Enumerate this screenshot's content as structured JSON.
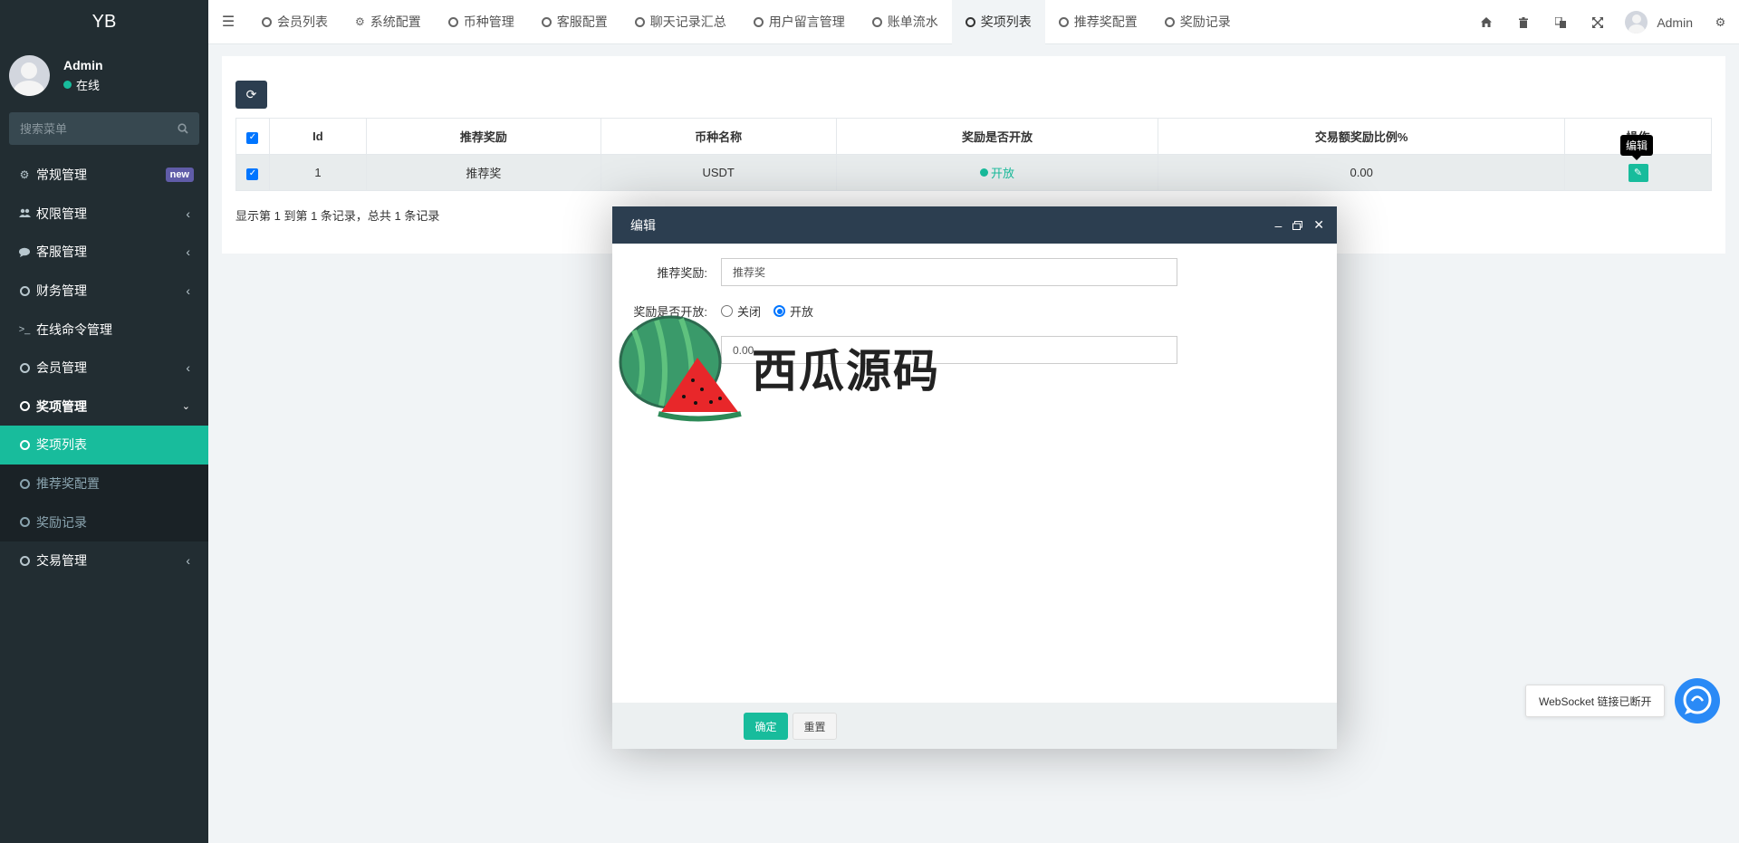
{
  "sidebar": {
    "logo": "YB",
    "user_name": "Admin",
    "user_status": "在线",
    "search_placeholder": "搜索菜单",
    "items": [
      {
        "label": "常规管理",
        "badge": "new"
      },
      {
        "label": "权限管理"
      },
      {
        "label": "客服管理"
      },
      {
        "label": "财务管理"
      },
      {
        "label": "在线命令管理"
      },
      {
        "label": "会员管理"
      },
      {
        "label": "奖项管理"
      },
      {
        "label": "奖项列表"
      },
      {
        "label": "推荐奖配置"
      },
      {
        "label": "奖励记录"
      },
      {
        "label": "交易管理"
      }
    ]
  },
  "topbar": {
    "tabs": [
      {
        "label": "会员列表",
        "icon": "circle-icon"
      },
      {
        "label": "系统配置",
        "icon": "gear-icon"
      },
      {
        "label": "币种管理",
        "icon": "circle-icon"
      },
      {
        "label": "客服配置",
        "icon": "circle-icon"
      },
      {
        "label": "聊天记录汇总",
        "icon": "circle-icon"
      },
      {
        "label": "用户留言管理",
        "icon": "circle-icon"
      },
      {
        "label": "账单流水",
        "icon": "circle-icon"
      },
      {
        "label": "奖项列表",
        "icon": "circle-icon"
      },
      {
        "label": "推荐奖配置",
        "icon": "circle-icon"
      },
      {
        "label": "奖励记录",
        "icon": "circle-icon"
      }
    ],
    "user_name": "Admin"
  },
  "table": {
    "headers": [
      "Id",
      "推荐奖励",
      "币种名称",
      "奖励是否开放",
      "交易额奖励比例%",
      "操作"
    ],
    "rows": [
      {
        "id": "1",
        "reward": "推荐奖",
        "coin": "USDT",
        "open": "开放",
        "ratio": "0.00"
      }
    ],
    "tooltip": "编辑",
    "pager_info": "显示第 1 到第 1 条记录，总共 1 条记录"
  },
  "dialog": {
    "title": "编辑",
    "fields": {
      "reward_label": "推荐奖励:",
      "reward_value": "推荐奖",
      "open_label": "奖励是否开放:",
      "opt_close": "关闭",
      "opt_open": "开放",
      "ratio_value": "0.00"
    },
    "ok_label": "确定",
    "reset_label": "重置"
  },
  "watermark": "西瓜源码",
  "ws_notice": "WebSocket 链接已断开",
  "colors": {
    "sidebar_bg": "#222d32",
    "accent": "#18bc9c",
    "header_dark": "#2c3e50",
    "new_badge": "#605ca8",
    "ws_blue": "#2a8af6"
  }
}
